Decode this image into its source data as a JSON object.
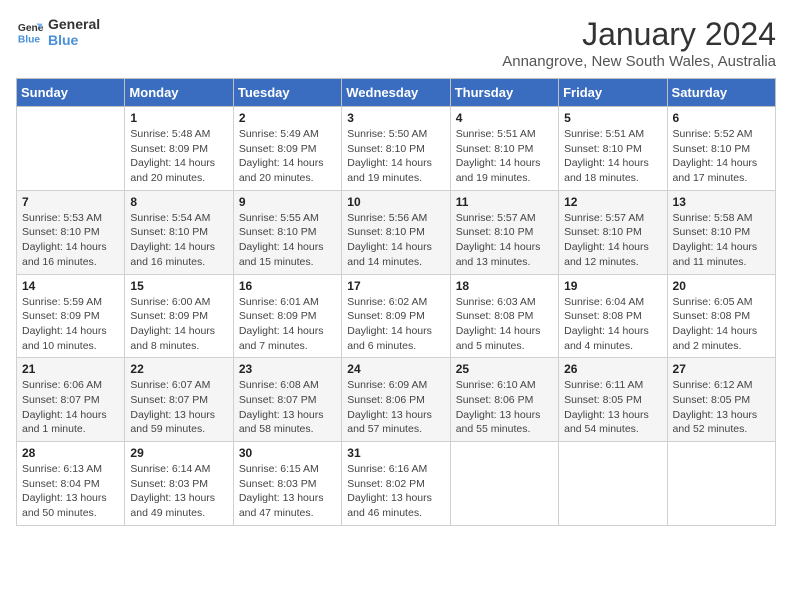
{
  "logo": {
    "line1": "General",
    "line2": "Blue"
  },
  "title": "January 2024",
  "subtitle": "Annangrove, New South Wales, Australia",
  "header_days": [
    "Sunday",
    "Monday",
    "Tuesday",
    "Wednesday",
    "Thursday",
    "Friday",
    "Saturday"
  ],
  "weeks": [
    [
      {
        "day": "",
        "info": ""
      },
      {
        "day": "1",
        "info": "Sunrise: 5:48 AM\nSunset: 8:09 PM\nDaylight: 14 hours\nand 20 minutes."
      },
      {
        "day": "2",
        "info": "Sunrise: 5:49 AM\nSunset: 8:09 PM\nDaylight: 14 hours\nand 20 minutes."
      },
      {
        "day": "3",
        "info": "Sunrise: 5:50 AM\nSunset: 8:10 PM\nDaylight: 14 hours\nand 19 minutes."
      },
      {
        "day": "4",
        "info": "Sunrise: 5:51 AM\nSunset: 8:10 PM\nDaylight: 14 hours\nand 19 minutes."
      },
      {
        "day": "5",
        "info": "Sunrise: 5:51 AM\nSunset: 8:10 PM\nDaylight: 14 hours\nand 18 minutes."
      },
      {
        "day": "6",
        "info": "Sunrise: 5:52 AM\nSunset: 8:10 PM\nDaylight: 14 hours\nand 17 minutes."
      }
    ],
    [
      {
        "day": "7",
        "info": "Sunrise: 5:53 AM\nSunset: 8:10 PM\nDaylight: 14 hours\nand 16 minutes."
      },
      {
        "day": "8",
        "info": "Sunrise: 5:54 AM\nSunset: 8:10 PM\nDaylight: 14 hours\nand 16 minutes."
      },
      {
        "day": "9",
        "info": "Sunrise: 5:55 AM\nSunset: 8:10 PM\nDaylight: 14 hours\nand 15 minutes."
      },
      {
        "day": "10",
        "info": "Sunrise: 5:56 AM\nSunset: 8:10 PM\nDaylight: 14 hours\nand 14 minutes."
      },
      {
        "day": "11",
        "info": "Sunrise: 5:57 AM\nSunset: 8:10 PM\nDaylight: 14 hours\nand 13 minutes."
      },
      {
        "day": "12",
        "info": "Sunrise: 5:57 AM\nSunset: 8:10 PM\nDaylight: 14 hours\nand 12 minutes."
      },
      {
        "day": "13",
        "info": "Sunrise: 5:58 AM\nSunset: 8:10 PM\nDaylight: 14 hours\nand 11 minutes."
      }
    ],
    [
      {
        "day": "14",
        "info": "Sunrise: 5:59 AM\nSunset: 8:09 PM\nDaylight: 14 hours\nand 10 minutes."
      },
      {
        "day": "15",
        "info": "Sunrise: 6:00 AM\nSunset: 8:09 PM\nDaylight: 14 hours\nand 8 minutes."
      },
      {
        "day": "16",
        "info": "Sunrise: 6:01 AM\nSunset: 8:09 PM\nDaylight: 14 hours\nand 7 minutes."
      },
      {
        "day": "17",
        "info": "Sunrise: 6:02 AM\nSunset: 8:09 PM\nDaylight: 14 hours\nand 6 minutes."
      },
      {
        "day": "18",
        "info": "Sunrise: 6:03 AM\nSunset: 8:08 PM\nDaylight: 14 hours\nand 5 minutes."
      },
      {
        "day": "19",
        "info": "Sunrise: 6:04 AM\nSunset: 8:08 PM\nDaylight: 14 hours\nand 4 minutes."
      },
      {
        "day": "20",
        "info": "Sunrise: 6:05 AM\nSunset: 8:08 PM\nDaylight: 14 hours\nand 2 minutes."
      }
    ],
    [
      {
        "day": "21",
        "info": "Sunrise: 6:06 AM\nSunset: 8:07 PM\nDaylight: 14 hours\nand 1 minute."
      },
      {
        "day": "22",
        "info": "Sunrise: 6:07 AM\nSunset: 8:07 PM\nDaylight: 13 hours\nand 59 minutes."
      },
      {
        "day": "23",
        "info": "Sunrise: 6:08 AM\nSunset: 8:07 PM\nDaylight: 13 hours\nand 58 minutes."
      },
      {
        "day": "24",
        "info": "Sunrise: 6:09 AM\nSunset: 8:06 PM\nDaylight: 13 hours\nand 57 minutes."
      },
      {
        "day": "25",
        "info": "Sunrise: 6:10 AM\nSunset: 8:06 PM\nDaylight: 13 hours\nand 55 minutes."
      },
      {
        "day": "26",
        "info": "Sunrise: 6:11 AM\nSunset: 8:05 PM\nDaylight: 13 hours\nand 54 minutes."
      },
      {
        "day": "27",
        "info": "Sunrise: 6:12 AM\nSunset: 8:05 PM\nDaylight: 13 hours\nand 52 minutes."
      }
    ],
    [
      {
        "day": "28",
        "info": "Sunrise: 6:13 AM\nSunset: 8:04 PM\nDaylight: 13 hours\nand 50 minutes."
      },
      {
        "day": "29",
        "info": "Sunrise: 6:14 AM\nSunset: 8:03 PM\nDaylight: 13 hours\nand 49 minutes."
      },
      {
        "day": "30",
        "info": "Sunrise: 6:15 AM\nSunset: 8:03 PM\nDaylight: 13 hours\nand 47 minutes."
      },
      {
        "day": "31",
        "info": "Sunrise: 6:16 AM\nSunset: 8:02 PM\nDaylight: 13 hours\nand 46 minutes."
      },
      {
        "day": "",
        "info": ""
      },
      {
        "day": "",
        "info": ""
      },
      {
        "day": "",
        "info": ""
      }
    ]
  ]
}
